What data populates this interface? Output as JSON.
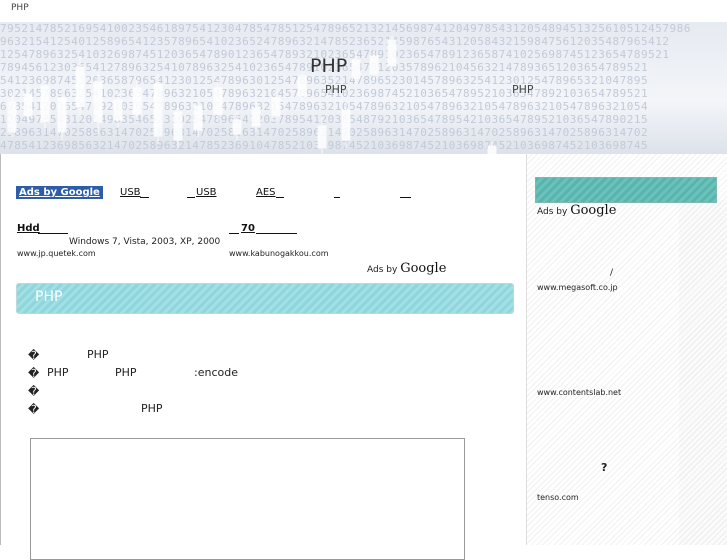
{
  "header": {
    "site_title": "PHP"
  },
  "banner": {
    "title": "PHP",
    "sub_left": "PHP",
    "sub_right": "PHP",
    "digits": [
      "7952147852169541002354618975412304785478512547896521321456987412049785431205489451325610512457986",
      "9632154125401258965412357896541023652478963214785236521459876543120584321598475612035487965412",
      "1254789632541032698745120365478901236547893210236547891023654789123658741025698745123654789521",
      "7894561230365412789632541078963254102365478910236547812035789621045632147893651203654789521",
      "5412369874512036587965412301254789630125478963521478965230145789632541230125478965321047895",
      "3021457896325410236547896321054789632104578965410236987452103654789521036547892103654789521",
      "6985412036547892103654789632105478963215478963210547896321054789632105478963210547896321054",
      "1204978543120549835465231025478965412037895412036548792103654789542103654789521036547890215",
      "2589631470258963147025896314702589631470258963147025896314702589631470258963147025896314702",
      "4785412369856321470258963214785236910478521036987452103698745210369874521036987452103698745"
    ]
  },
  "ads": {
    "badge": "Ads by Google",
    "links": [
      "USB",
      "USB",
      "AES",
      "",
      ""
    ],
    "text_ads": [
      {
        "title": "Hdd",
        "desc": "Windows 7, Vista, 2003, XP, 2000",
        "url": "www.jp.quetek.com"
      },
      {
        "title": "70",
        "desc": "",
        "url": "www.kabunogakkou.com"
      }
    ],
    "ads_by": "Ads by",
    "google": "Google"
  },
  "main": {
    "section_title": "PHP",
    "bullets": [
      {
        "mark": "�",
        "a": "PHP",
        "b": "",
        "c": ""
      },
      {
        "mark": "�",
        "a": "PHP",
        "b": "PHP",
        "c": ":encode"
      },
      {
        "mark": "�",
        "a": "",
        "b": "",
        "c": ""
      },
      {
        "mark": "�",
        "a": "PHP",
        "b": "",
        "c": ""
      }
    ]
  },
  "sidebar": {
    "ads_by": "Ads by",
    "google": "Google",
    "slash": "/",
    "url1": "www.megasoft.co.jp",
    "url2": "www.contentslab.net",
    "question": "?",
    "url3": "tenso.com"
  }
}
